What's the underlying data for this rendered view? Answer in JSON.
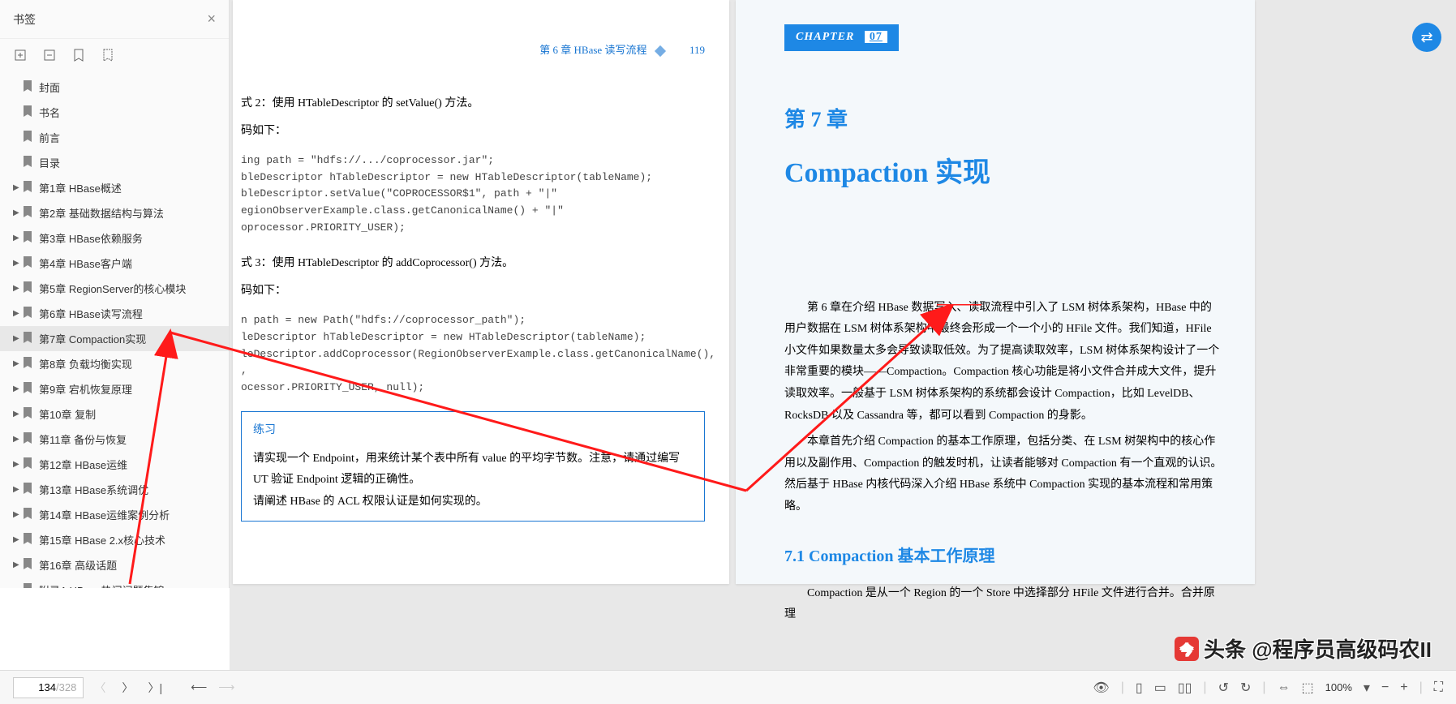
{
  "sidebar": {
    "title": "书签",
    "items": [
      {
        "label": "封面",
        "leaf": true
      },
      {
        "label": "书名",
        "leaf": true
      },
      {
        "label": "前言",
        "leaf": true
      },
      {
        "label": "目录",
        "leaf": true
      },
      {
        "label": "第1章 HBase概述"
      },
      {
        "label": "第2章 基础数据结构与算法"
      },
      {
        "label": "第3章 HBase依赖服务"
      },
      {
        "label": "第4章 HBase客户端"
      },
      {
        "label": "第5章 RegionServer的核心模块"
      },
      {
        "label": "第6章 HBase读写流程"
      },
      {
        "label": "第7章 Compaction实现",
        "selected": true
      },
      {
        "label": "第8章 负载均衡实现"
      },
      {
        "label": "第9章 宕机恢复原理"
      },
      {
        "label": "第10章 复制"
      },
      {
        "label": "第11章 备份与恢复"
      },
      {
        "label": "第12章 HBase运维"
      },
      {
        "label": "第13章 HBase系统调优"
      },
      {
        "label": "第14章 HBase运维案例分析"
      },
      {
        "label": "第15章 HBase 2.x核心技术"
      },
      {
        "label": "第16章 高级话题"
      },
      {
        "label": "附录A   HBase热门问题集锦",
        "leaf": true
      }
    ]
  },
  "leftPage": {
    "header": "第 6 章   HBase 读写流程",
    "pageNum": "119",
    "m2head": "式 2：使用 HTableDescriptor 的 setValue() 方法。",
    "m2sub": "码如下：",
    "code1": "ing path = \"hdfs://.../coprocessor.jar\";\nbleDescriptor hTableDescriptor = new HTableDescriptor(tableName);\nbleDescriptor.setValue(\"COPROCESSOR$1\", path + \"|\"\negionObserverExample.class.getCanonicalName() + \"|\"\noprocessor.PRIORITY_USER);",
    "m3head": "式 3：使用 HTableDescriptor 的 addCoprocessor() 方法。",
    "m3sub": "码如下：",
    "code2": "n path = new Path(\"hdfs://coprocessor_path\");\nleDescriptor hTableDescriptor = new HTableDescriptor(tableName);\nleDescriptor.addCoprocessor(RegionObserverExample.class.getCanonicalName(),\n,\nocessor.PRIORITY_USER, null);",
    "exTitle": "练习",
    "exLine1": "请实现一个 Endpoint，用来统计某个表中所有 value 的平均字节数。注意，请通过编写 UT 验证 Endpoint 逻辑的正确性。",
    "exLine2": "请阐述 HBase 的 ACL 权限认证是如何实现的。"
  },
  "rightPage": {
    "chapterWord": "CHAPTER",
    "chapterNum": "07",
    "chTitle": "第 7 章",
    "chSub": "Compaction 实现",
    "p1": "第 6 章在介绍 HBase 数据写入、读取流程中引入了 LSM 树体系架构，HBase 中的用户数据在 LSM 树体系架构中最终会形成一个一个小的 HFile 文件。我们知道，HFile 小文件如果数量太多会导致读取低效。为了提高读取效率，LSM 树体系架构设计了一个非常重要的模块——Compaction。Compaction 核心功能是将小文件合并成大文件，提升读取效率。一般基于 LSM 树体系架构的系统都会设计 Compaction，比如 LevelDB、RocksDB 以及 Cassandra 等，都可以看到 Compaction 的身影。",
    "p2": "本章首先介绍 Compaction 的基本工作原理，包括分类、在 LSM 树架构中的核心作用以及副作用、Compaction 的触发时机，让读者能够对 Compaction 有一个直观的认识。然后基于 HBase 内核代码深入介绍 HBase 系统中 Compaction 实现的基本流程和常用策略。",
    "sec71": "7.1   Compaction 基本工作原理",
    "p3": "Compaction 是从一个 Region 的一个 Store 中选择部分 HFile 文件进行合并。合并原理"
  },
  "bottom": {
    "current": "134",
    "total": "/328",
    "zoom": "100%"
  },
  "watermark": "头条 @程序员高级码农II"
}
